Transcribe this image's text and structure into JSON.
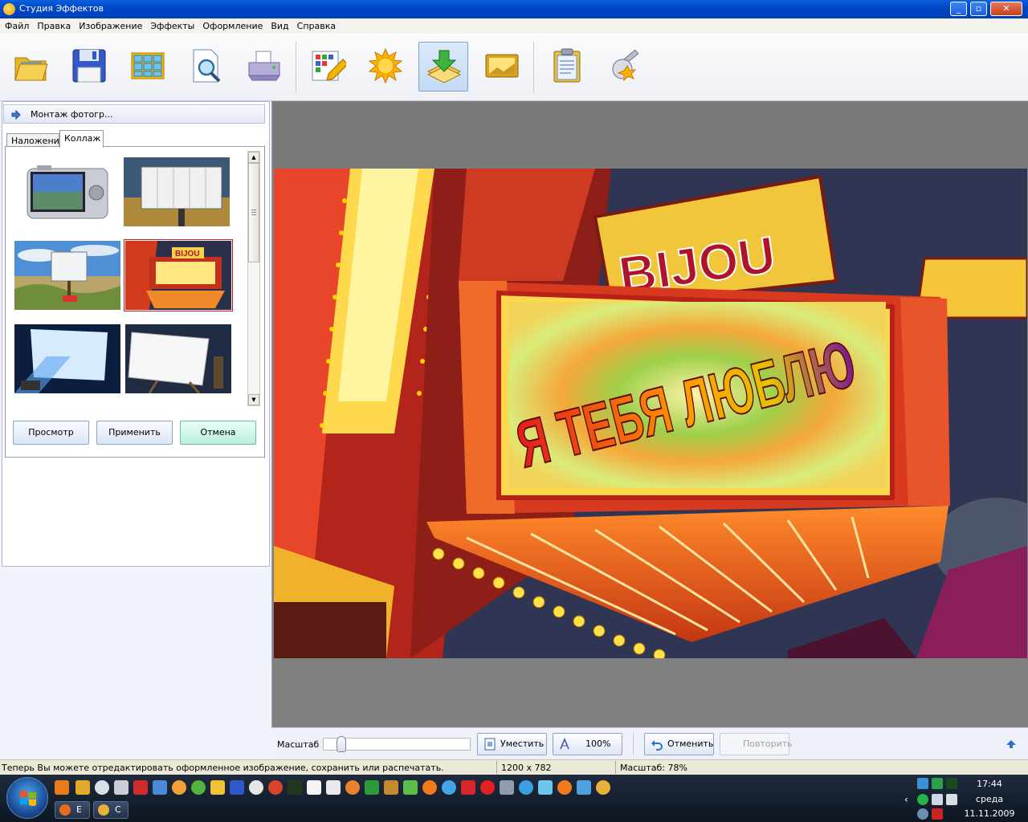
{
  "window": {
    "title": "Студия Эффектов"
  },
  "menu": [
    "Файл",
    "Правка",
    "Изображение",
    "Эффекты",
    "Оформление",
    "Вид",
    "Справка"
  ],
  "toolbar": {
    "icons": [
      "open-folder-icon",
      "save-floppy-icon",
      "grid-icon",
      "preview-magnifier-icon",
      "printer-icon",
      "edit-pencil-icon",
      "sun-effects-icon",
      "frame-download-icon",
      "picture-frame-icon",
      "clipboard-icon",
      "key-settings-icon"
    ],
    "active": "frame-download-icon"
  },
  "panel": {
    "header": "Монтаж фотогр...",
    "tabs": [
      "Наложение",
      "Коллаж"
    ],
    "selected_tab": "Коллаж",
    "thumbnails": [
      "camera",
      "billboard-field",
      "beach-sign",
      "bijou-marquee",
      "projector-screen",
      "easel-canvas"
    ],
    "selected_thumbnail": "bijou-marquee",
    "buttons": {
      "preview": "Просмотр",
      "apply": "Применить",
      "cancel": "Отмена"
    }
  },
  "canvas": {
    "marquee_text": "BIJOU",
    "sign_text": "Я ТЕБЯ ЛЮБЛЮ"
  },
  "zoombar": {
    "label": "Масштаб",
    "zoom_fraction": 0.1,
    "fit": "Уместить",
    "actual": "100%",
    "undo": "Отменить",
    "redo": "Повторить"
  },
  "status": {
    "message": "Теперь Вы можете отредактировать оформленное изображение, сохранить или распечатать.",
    "dimensions": "1200 x 782",
    "zoom": "Масштаб: 78%"
  },
  "taskbar": {
    "tasks": [
      "E",
      "C"
    ],
    "time": "17:44",
    "weekday": "среда",
    "date": "11.11.2009"
  },
  "colors": {
    "titlebar": "#0a5fdc",
    "cancel_button": "#b9eedb",
    "selection_outline": "#dd1111"
  }
}
